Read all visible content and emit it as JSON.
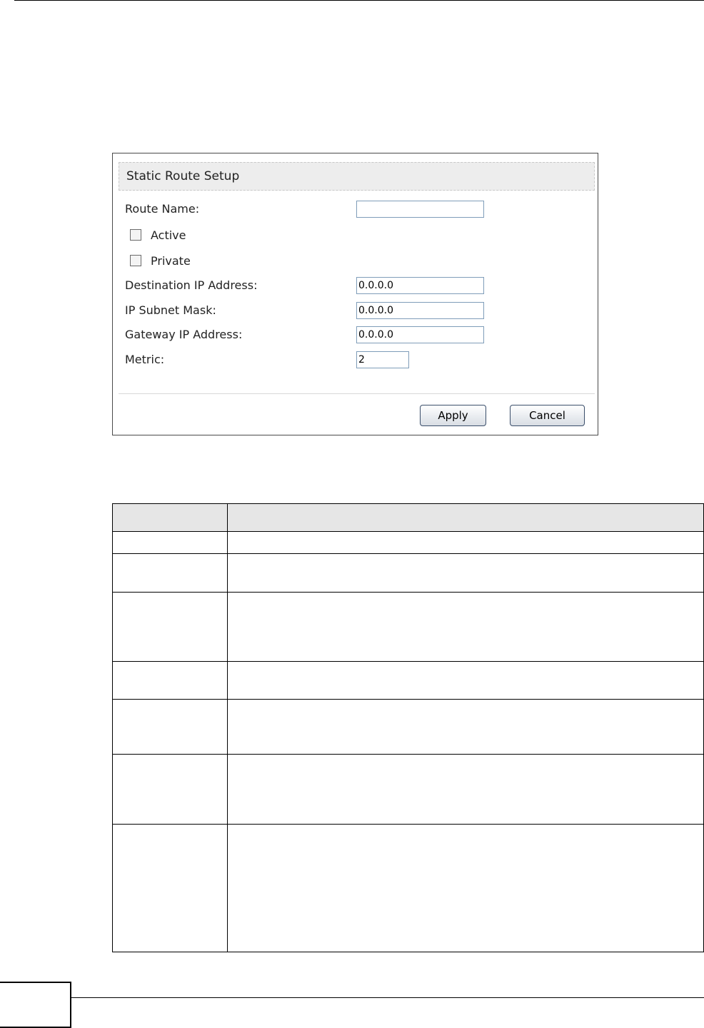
{
  "panel": {
    "title": "Static Route Setup",
    "route_name_label": "Route Name:",
    "route_name_value": "",
    "active_label": "Active",
    "active_checked": false,
    "private_label": "Private",
    "private_checked": false,
    "dest_ip_label": "Destination IP Address:",
    "dest_ip_value": "0.0.0.0",
    "subnet_mask_label": "IP Subnet Mask:",
    "subnet_mask_value": "0.0.0.0",
    "gateway_ip_label": "Gateway IP Address:",
    "gateway_ip_value": "0.0.0.0",
    "metric_label": "Metric:",
    "metric_value": "2",
    "apply_label": "Apply",
    "cancel_label": "Cancel"
  },
  "table": {
    "row_count": 8
  }
}
